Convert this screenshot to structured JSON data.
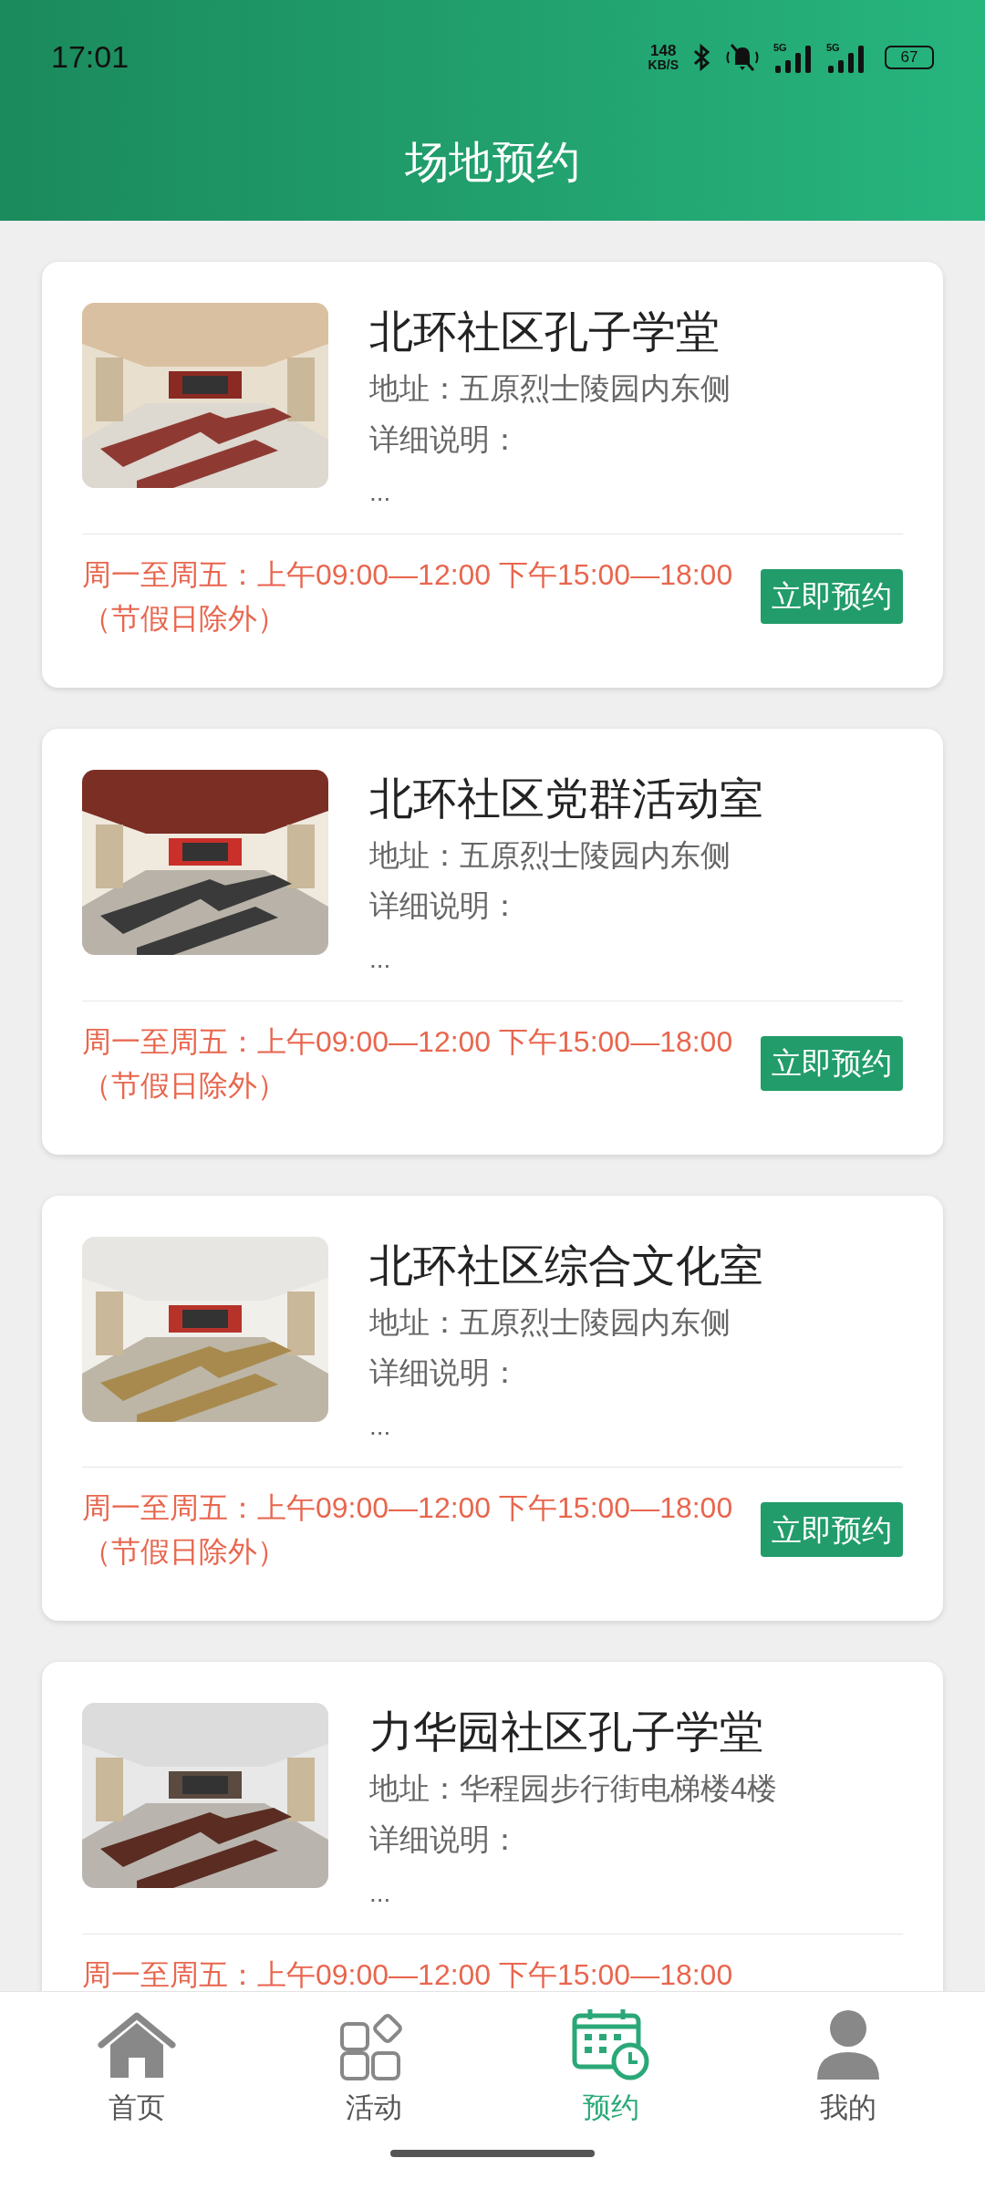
{
  "status_bar": {
    "time": "17:01",
    "net_speed": "148",
    "net_unit": "KB/S",
    "network_1": "5G",
    "network_2": "5G",
    "battery": "67"
  },
  "header": {
    "title": "场地预约"
  },
  "venues": [
    {
      "name": "北环社区孔子学堂",
      "address": "地址：五原烈士陵园内东侧",
      "detail": "详细说明：",
      "more": "...",
      "hours": "周一至周五：上午09:00—12:00 下午15:00—18:00（节假日除外）",
      "button": "立即预约"
    },
    {
      "name": "北环社区党群活动室",
      "address": "地址：五原烈士陵园内东侧",
      "detail": "详细说明：",
      "more": "...",
      "hours": "周一至周五：上午09:00—12:00 下午15:00—18:00（节假日除外）",
      "button": "立即预约"
    },
    {
      "name": "北环社区综合文化室",
      "address": "地址：五原烈士陵园内东侧",
      "detail": "详细说明：",
      "more": "...",
      "hours": "周一至周五：上午09:00—12:00 下午15:00—18:00（节假日除外）",
      "button": "立即预约"
    },
    {
      "name": "力华园社区孔子学堂",
      "address": "地址：华程园步行街电梯楼4楼",
      "detail": "详细说明：",
      "more": "...",
      "hours": "周一至周五：上午09:00—12:00 下午15:00—18:00"
    }
  ],
  "tab_bar": [
    {
      "label": "首页",
      "kind": "home",
      "selected": false
    },
    {
      "label": "活动",
      "kind": "apps",
      "selected": false
    },
    {
      "label": "预约",
      "kind": "calendar",
      "selected": true
    },
    {
      "label": "我的",
      "kind": "user",
      "selected": false
    }
  ]
}
